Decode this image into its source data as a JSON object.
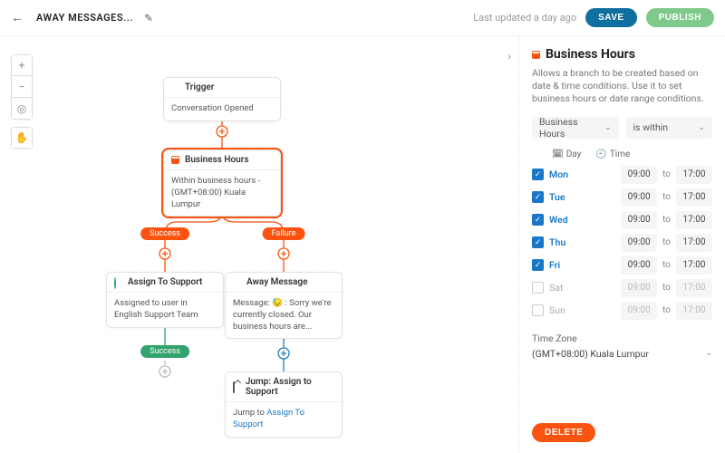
{
  "header": {
    "title": "AWAY MESSAGES...",
    "last_updated": "Last updated a day ago",
    "save": "SAVE",
    "publish": "PUBLISH"
  },
  "flow": {
    "trigger": {
      "title": "Trigger",
      "body": "Conversation Opened"
    },
    "business_hours": {
      "title": "Business Hours",
      "body": "Within business hours - (GMT+08:00) Kuala Lumpur"
    },
    "branch_success": "Success",
    "branch_failure": "Failure",
    "assign_support": {
      "title": "Assign To Support",
      "body": "Assigned to user in English Support Team"
    },
    "assign_success": "Success",
    "away_message": {
      "title": "Away Message",
      "body_prefix": "Message: ",
      "emoji": "😓",
      "body_rest": " : Sorry we're currently closed. Our business hours are..."
    },
    "jump": {
      "title": "Jump: Assign to Support",
      "prefix": "Jump to ",
      "target": "Assign To Support"
    }
  },
  "panel": {
    "title": "Business Hours",
    "desc": "Allows a branch to be created based on date & time conditions. Use it to set business hours or date range conditions.",
    "select1": "Business Hours",
    "select2": "is within",
    "col_day": "Day",
    "col_time": "Time",
    "days": [
      {
        "name": "Mon",
        "on": true,
        "from": "09:00",
        "to": "17:00"
      },
      {
        "name": "Tue",
        "on": true,
        "from": "09:00",
        "to": "17:00"
      },
      {
        "name": "Wed",
        "on": true,
        "from": "09:00",
        "to": "17:00"
      },
      {
        "name": "Thu",
        "on": true,
        "from": "09:00",
        "to": "17:00"
      },
      {
        "name": "Fri",
        "on": true,
        "from": "09:00",
        "to": "17:00"
      },
      {
        "name": "Sat",
        "on": false,
        "from": "09:00",
        "to": "17:00"
      },
      {
        "name": "Sun",
        "on": false,
        "from": "09:00",
        "to": "17:00"
      }
    ],
    "to_label": "to",
    "tz_label": "Time Zone",
    "tz_value": "(GMT+08:00) Kuala Lumpur",
    "delete": "DELETE"
  }
}
